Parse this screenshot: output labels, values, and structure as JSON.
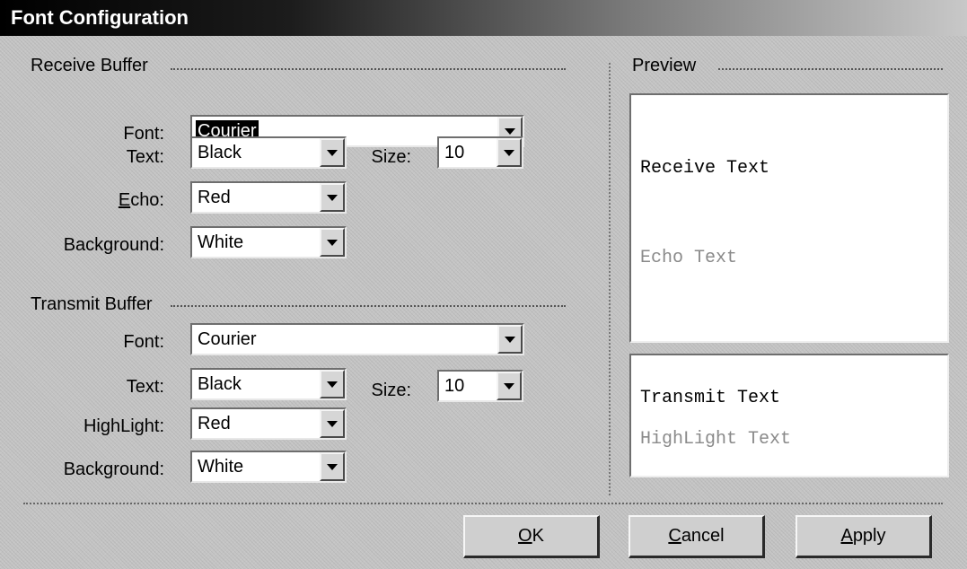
{
  "window": {
    "title": "Font Configuration"
  },
  "receive": {
    "group_label": "Receive Buffer",
    "font_label": "Font:",
    "font_value": "Courier",
    "text_label": "Text:",
    "text_value": "Black",
    "size_label": "Size:",
    "size_value": "10",
    "echo_label_mnemonic": "E",
    "echo_label_rest": "cho:",
    "echo_value": "Red",
    "background_label": "Background:",
    "background_value": "White"
  },
  "transmit": {
    "group_label": "Transmit Buffer",
    "font_label": "Font:",
    "font_value": "Courier",
    "text_label": "Text:",
    "text_value": "Black",
    "size_label": "Size:",
    "size_value": "10",
    "highlight_label": "HighLight:",
    "highlight_value": "Red",
    "background_label": "Background:",
    "background_value": "White"
  },
  "preview": {
    "group_label": "Preview",
    "receive_text": "Receive Text",
    "echo_text": "Echo Text",
    "transmit_text": "Transmit Text",
    "highlight_text": "HighLight Text",
    "colors": {
      "receive": "#000000",
      "echo": "#8a8a8a",
      "transmit": "#000000",
      "highlight": "#8a8a8a"
    }
  },
  "buttons": {
    "ok_mnemonic": "O",
    "ok_rest": "K",
    "cancel_mnemonic": "C",
    "cancel_rest": "ancel",
    "apply_mnemonic": "A",
    "apply_rest": "pply"
  },
  "icons": {
    "dropdown": "chevron-down-icon"
  }
}
